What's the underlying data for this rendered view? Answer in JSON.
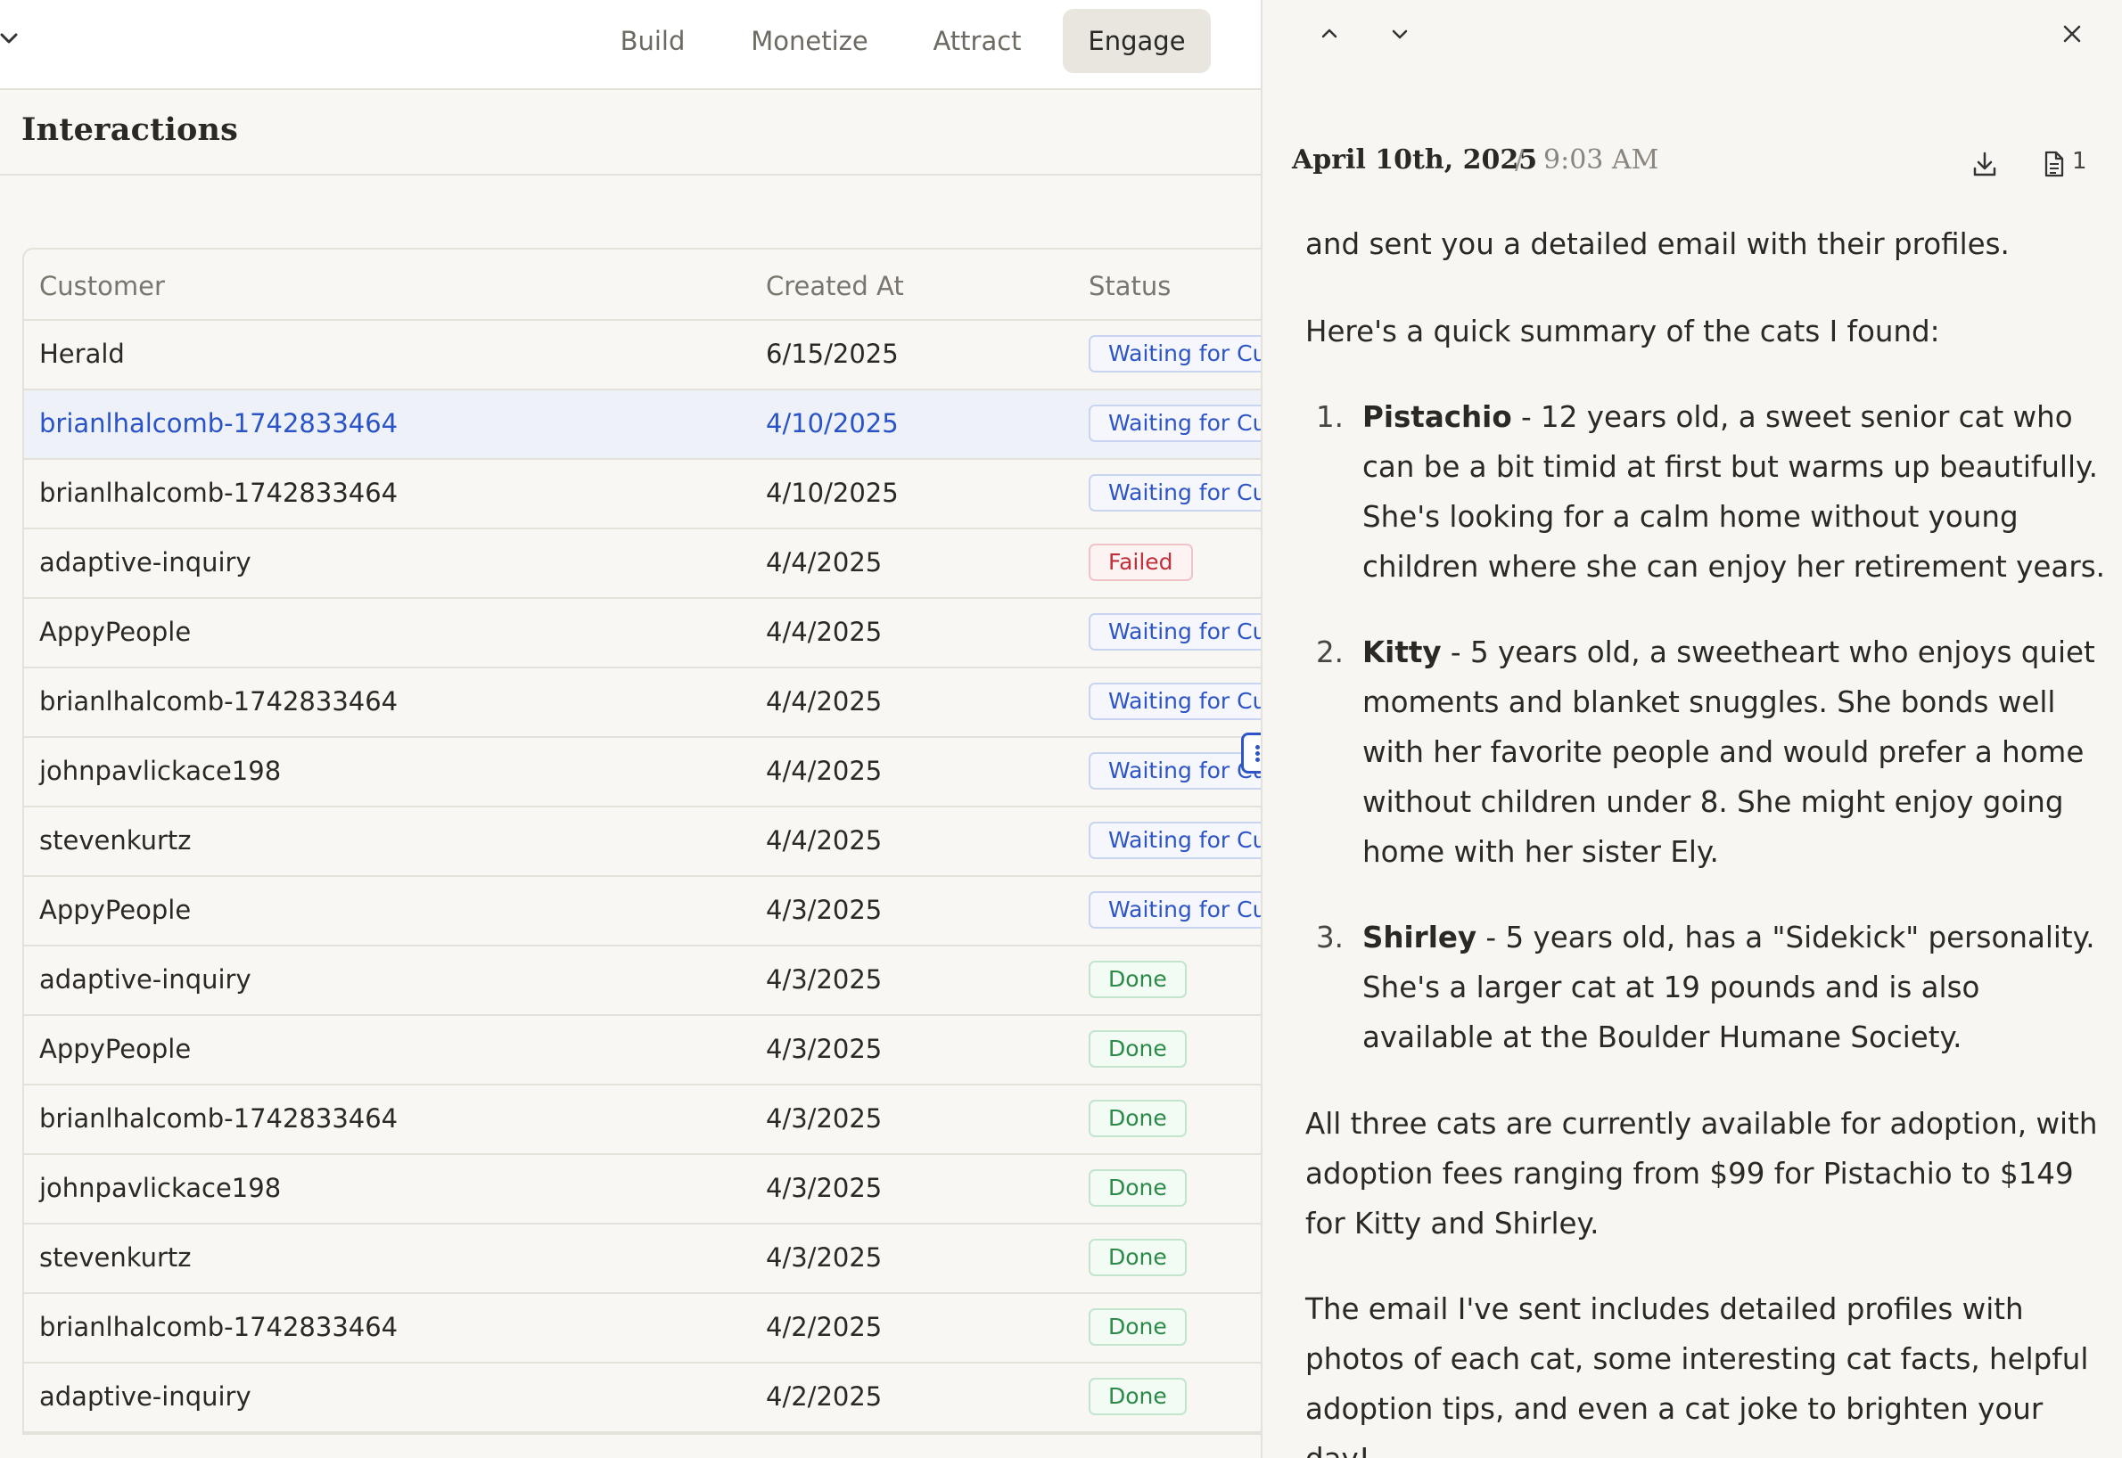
{
  "nav": {
    "tabs": [
      "Build",
      "Monetize",
      "Attract",
      "Engage"
    ],
    "active_tab": "Engage"
  },
  "page": {
    "title": "Interactions"
  },
  "table": {
    "columns": [
      "Customer",
      "Created At",
      "Status"
    ],
    "rows": [
      {
        "customer": "Herald",
        "created_at": "6/15/2025",
        "status": "Waiting for Cus",
        "kind": "waiting"
      },
      {
        "customer": "brianlhalcomb-1742833464",
        "created_at": "4/10/2025",
        "status": "Waiting for Cus",
        "kind": "waiting",
        "selected": true
      },
      {
        "customer": "brianlhalcomb-1742833464",
        "created_at": "4/10/2025",
        "status": "Waiting for Cus",
        "kind": "waiting"
      },
      {
        "customer": "adaptive-inquiry",
        "created_at": "4/4/2025",
        "status": "Failed",
        "kind": "failed"
      },
      {
        "customer": "AppyPeople",
        "created_at": "4/4/2025",
        "status": "Waiting for Cus",
        "kind": "waiting"
      },
      {
        "customer": "brianlhalcomb-1742833464",
        "created_at": "4/4/2025",
        "status": "Waiting for Cus",
        "kind": "waiting"
      },
      {
        "customer": "johnpavlickace198",
        "created_at": "4/4/2025",
        "status": "Waiting for Cus",
        "kind": "waiting"
      },
      {
        "customer": "stevenkurtz",
        "created_at": "4/4/2025",
        "status": "Waiting for Cus",
        "kind": "waiting"
      },
      {
        "customer": "AppyPeople",
        "created_at": "4/3/2025",
        "status": "Waiting for Cus",
        "kind": "waiting"
      },
      {
        "customer": "adaptive-inquiry",
        "created_at": "4/3/2025",
        "status": "Done",
        "kind": "done"
      },
      {
        "customer": "AppyPeople",
        "created_at": "4/3/2025",
        "status": "Done",
        "kind": "done"
      },
      {
        "customer": "brianlhalcomb-1742833464",
        "created_at": "4/3/2025",
        "status": "Done",
        "kind": "done"
      },
      {
        "customer": "johnpavlickace198",
        "created_at": "4/3/2025",
        "status": "Done",
        "kind": "done"
      },
      {
        "customer": "stevenkurtz",
        "created_at": "4/3/2025",
        "status": "Done",
        "kind": "done"
      },
      {
        "customer": "brianlhalcomb-1742833464",
        "created_at": "4/2/2025",
        "status": "Done",
        "kind": "done"
      },
      {
        "customer": "adaptive-inquiry",
        "created_at": "4/2/2025",
        "status": "Done",
        "kind": "done"
      }
    ]
  },
  "detail": {
    "date": "April 10th, 2025",
    "separator": "/",
    "time": "9:03 AM",
    "attachment_count": "1",
    "cut_off_line": "and sent you a detailed email with their profiles.",
    "intro": "Here's a quick summary of the cats I found:",
    "cats": [
      {
        "num": "1.",
        "name": "Pistachio",
        "desc": " - 12 years old, a sweet senior cat who can be a bit timid at first but warms up beautifully. She's looking for a calm home without young children where she can enjoy her retirement years."
      },
      {
        "num": "2.",
        "name": "Kitty",
        "desc": " - 5 years old, a sweetheart who enjoys quiet moments and blanket snuggles. She bonds well with her favorite people and would prefer a home without children under 8. She might enjoy going home with her sister Ely."
      },
      {
        "num": "3.",
        "name": "Shirley",
        "desc": " - 5 years old, has a \"Sidekick\" personality. She's a larger cat at 19 pounds and is also available at the Boulder Humane Society."
      }
    ],
    "para_fees": "All three cats are currently available for adoption, with adoption fees ranging from $99 for Pistachio to $149 for Kitty and Shirley.",
    "para_email": "The email I've sent includes detailed profiles with photos of each cat, some interesting cat facts, helpful adoption tips, and even a cat joke to brighten your day!"
  },
  "colors": {
    "accent": "#2d55c8",
    "waiting": "#2d55c8",
    "failed": "#c0303a",
    "done": "#2b8a48"
  },
  "icons": [
    "chevron-down-icon",
    "chevron-up-icon",
    "close-icon",
    "download-icon",
    "document-icon",
    "drag-handle-icon"
  ]
}
